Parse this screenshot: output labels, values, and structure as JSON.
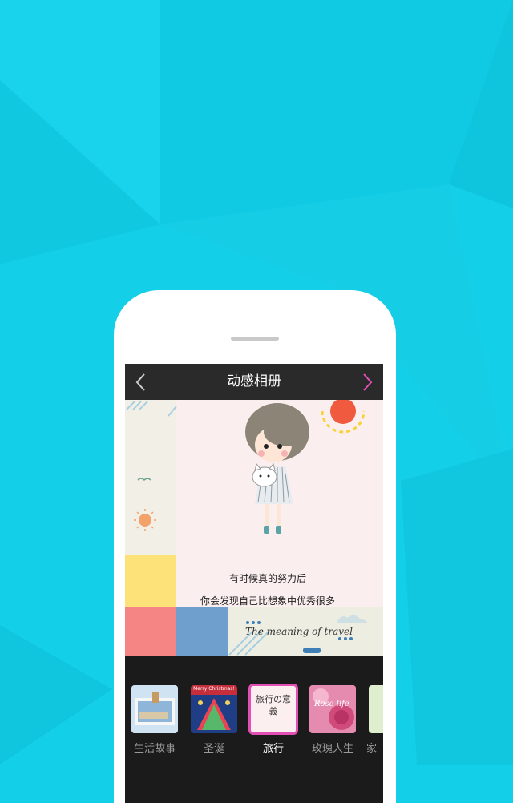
{
  "header": {
    "title": "动感相册",
    "back_icon": "chevron-left-icon",
    "next_icon": "chevron-right-icon"
  },
  "album": {
    "quote_line1": "有时候真的努力后",
    "quote_line2": "你会发现自己比想象中优秀很多",
    "caption": "The meaning of travel"
  },
  "templates": [
    {
      "label": "生活故事",
      "selected": false,
      "thumb_text": ""
    },
    {
      "label": "圣诞",
      "selected": false,
      "thumb_text": "Merry Christmas!"
    },
    {
      "label": "旅行",
      "selected": true,
      "thumb_text": "旅行の意義"
    },
    {
      "label": "玫瑰人生",
      "selected": false,
      "thumb_text": "Rose life"
    },
    {
      "label": "家",
      "selected": false,
      "thumb_text": ""
    }
  ],
  "colors": {
    "background": "#14cfe8",
    "accent": "#e24fb5",
    "titlebar": "#2a2a2a"
  }
}
